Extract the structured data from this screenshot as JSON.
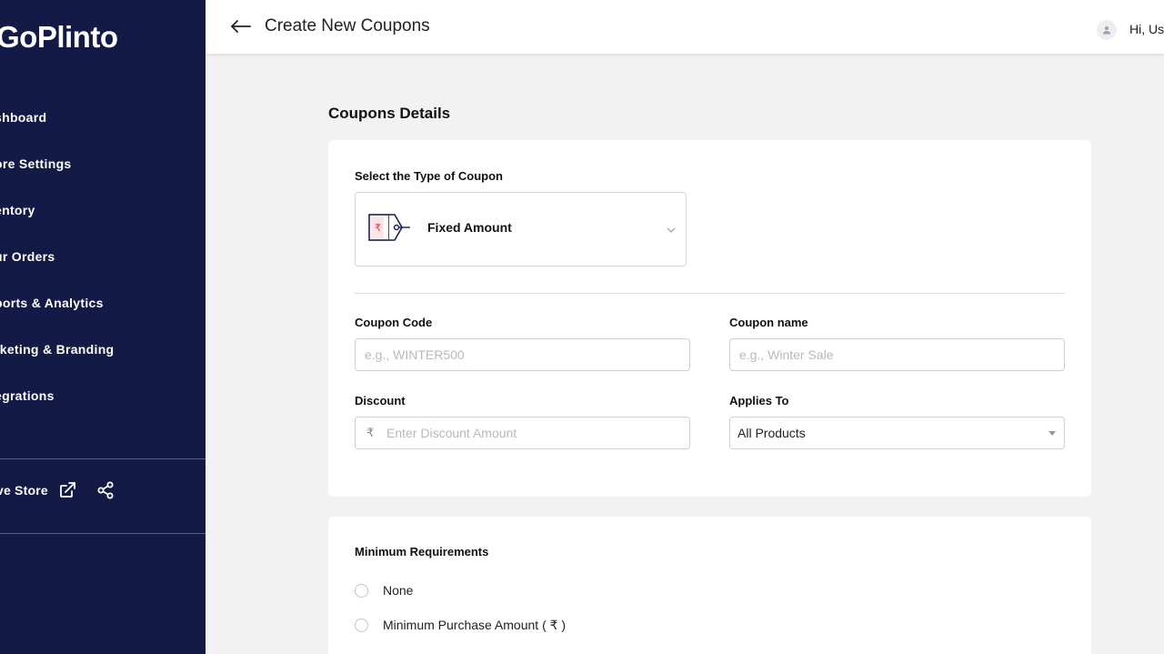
{
  "sidebar": {
    "logo": "GoPlinto",
    "items": [
      {
        "label": "shboard"
      },
      {
        "label": "ore Settings"
      },
      {
        "label": "entory"
      },
      {
        "label": "ur Orders"
      },
      {
        "label": "ports & Analytics"
      },
      {
        "label": "rketing & Branding"
      },
      {
        "label": "egrations"
      }
    ],
    "store_label": "ve Store",
    "external_icon": "external-link-icon",
    "share_icon": "share-icon"
  },
  "header": {
    "back_icon": "arrow-left-icon",
    "title": "Create New Coupons",
    "user_icon": "user-icon",
    "greeting": "Hi, Use"
  },
  "main": {
    "section_title": "Coupons Details",
    "coupon_type": {
      "label": "Select the Type of Coupon",
      "selected": "Fixed Amount",
      "icon": "price-tag-rupee-icon"
    },
    "coupon_code": {
      "label": "Coupon Code",
      "placeholder": "e.g., WINTER500",
      "value": ""
    },
    "coupon_name": {
      "label": "Coupon name",
      "placeholder": "e.g., Winter Sale",
      "value": ""
    },
    "discount": {
      "label": "Discount",
      "prefix": "₹",
      "placeholder": "Enter Discount Amount",
      "value": ""
    },
    "applies_to": {
      "label": "Applies To",
      "selected": "All Products"
    },
    "min_requirements": {
      "title": "Minimum Requirements",
      "options": [
        {
          "label": "None"
        },
        {
          "label": "Minimum Purchase Amount  ( ₹ )"
        }
      ]
    }
  },
  "colors": {
    "sidebar_bg": "#131a45",
    "page_bg": "#f2f2f2",
    "card_bg": "#ffffff",
    "tag_accent": "#e0344a"
  }
}
